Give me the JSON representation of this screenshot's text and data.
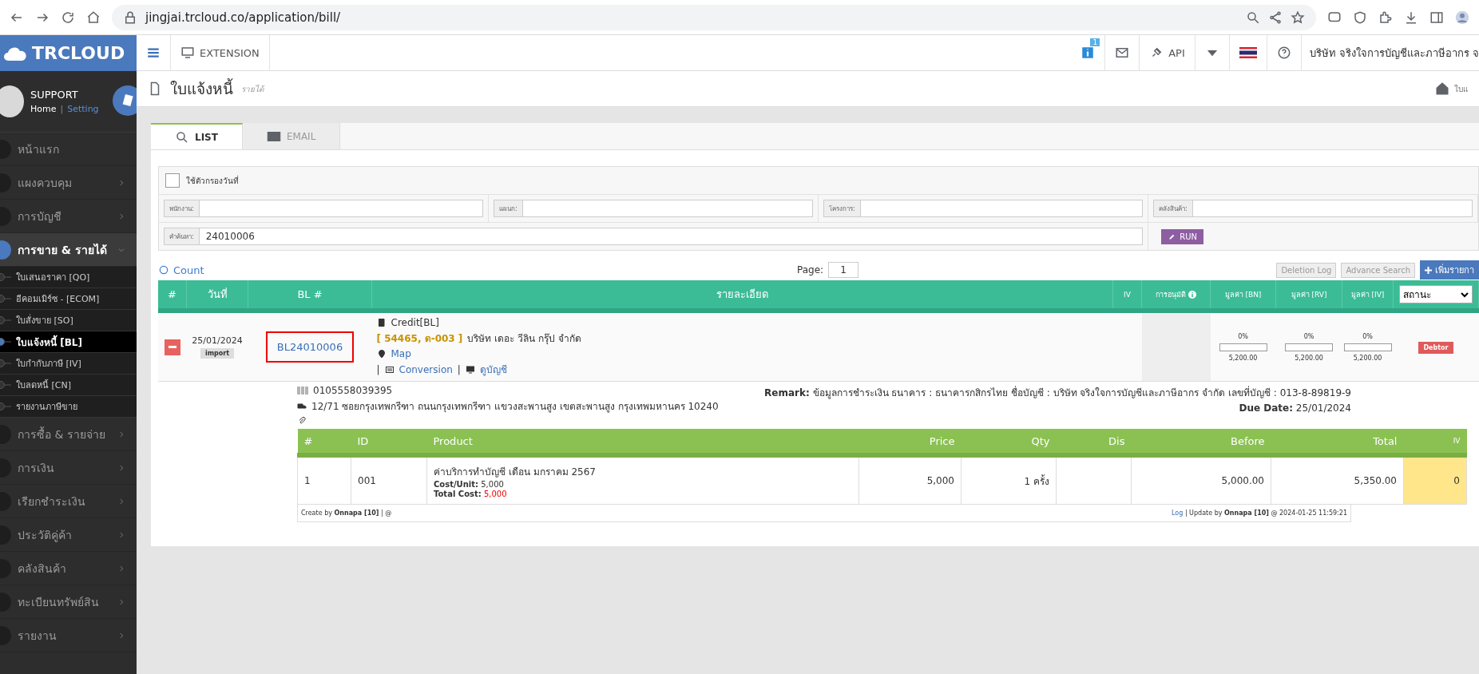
{
  "browser": {
    "url": "jingjai.trcloud.co/application/bill/"
  },
  "navbar": {
    "logo": "TRCLOUD",
    "extension": "EXTENSION",
    "notification_count": "1",
    "api": "API",
    "company": "บริษัท จริงใจการบัญชีและภาษีอากร จ"
  },
  "profile": {
    "name": "SUPPORT",
    "separator": "|",
    "links": [
      {
        "label": "Home",
        "selected": true
      },
      {
        "label": "Setting",
        "selected": false
      }
    ]
  },
  "sidebar": {
    "items": [
      {
        "label": "หน้าแรก",
        "kind": "link",
        "expanded": false
      },
      {
        "label": "แผงควบคุม",
        "kind": "menu",
        "expanded": false
      },
      {
        "label": "การบัญชี",
        "kind": "menu",
        "expanded": false
      },
      {
        "label": "การขาย & รายได้",
        "kind": "menu",
        "expanded": true,
        "children": [
          {
            "label": "ใบเสนอราคา [QO]",
            "selected": false
          },
          {
            "label": "อีคอมเมิร์ซ - [ECOM]",
            "selected": false
          },
          {
            "label": "ใบสั่งขาย [SO]",
            "selected": false
          },
          {
            "label": "ใบแจ้งหนี้ [BL]",
            "selected": true
          },
          {
            "label": "ใบกำกับภาษี [IV]",
            "selected": false
          },
          {
            "label": "ใบลดหนี้ [CN]",
            "selected": false
          },
          {
            "label": "รายงานภาษีขาย",
            "selected": false
          }
        ]
      },
      {
        "label": "การซื้อ & รายจ่าย",
        "kind": "menu",
        "expanded": false
      },
      {
        "label": "การเงิน",
        "kind": "menu",
        "expanded": false
      },
      {
        "label": "เรียกชำระเงิน",
        "kind": "menu",
        "expanded": false
      },
      {
        "label": "ประวัติคู่ค้า",
        "kind": "menu",
        "expanded": false
      },
      {
        "label": "คลังสินค้า",
        "kind": "menu",
        "expanded": false
      },
      {
        "label": "ทะเบียนทรัพย์สิน",
        "kind": "menu",
        "expanded": false
      },
      {
        "label": "รายงาน",
        "kind": "menu",
        "expanded": false
      }
    ]
  },
  "page_header": {
    "title": "ใบแจ้งหนี้",
    "subtitle": "รายได้",
    "breadcrumb": "ใบแ"
  },
  "tabs": [
    {
      "label": "LIST",
      "selected": true
    },
    {
      "label": "EMAIL",
      "selected": false
    }
  ],
  "filter": {
    "date_filter": {
      "label": "ใช้ตัวกรองวันที่",
      "checked": false
    },
    "fields": [
      {
        "label": "พนักงาน:"
      },
      {
        "label": "แผนก:"
      },
      {
        "label": "โครงการ:"
      },
      {
        "label": "คลังสินค้า:"
      }
    ],
    "search": {
      "label": "คำค้นหา:",
      "value": "24010006"
    },
    "run": "RUN"
  },
  "toolbar": {
    "count": "Count",
    "page_label": "Page:",
    "page": "1",
    "buttons": [
      "Deletion Log",
      "Advance Search"
    ],
    "add": "เพิ่มรายกา"
  },
  "table": {
    "columns": [
      "#",
      "วันที่",
      "BL #",
      "รายละเอียด",
      "IV",
      "การอนุมัติ",
      "มูลค่า [BN]",
      "มูลค่า [RV]",
      "มูลค่า [IV]"
    ],
    "status_select": "สถานะ",
    "rows": [
      {
        "date": "25/01/2024",
        "tag": "import",
        "number": "BL24010006",
        "highlighted": true,
        "doc_type": "Credit[BL]",
        "code": "[ 54465, ด-003 ]",
        "customer": "บริษัท เดอะ วีลิน กรุ๊ป จำกัด",
        "map": "Map",
        "separator": "|",
        "conversion": "Conversion",
        "account": "ดูบัญชี",
        "values": [
          {
            "percent": "0%",
            "level": 0,
            "amount": "5,200.00"
          },
          {
            "percent": "0%",
            "level": 0,
            "amount": "5,200.00"
          },
          {
            "percent": "0%",
            "level": 0,
            "amount": "5,200.00"
          }
        ],
        "status": "Debtor"
      }
    ]
  },
  "detail": {
    "tax_id": "0105558039395",
    "address": "12/71 ซอยกรุงเทพกรีฑา ถนนกรุงเทพกรีฑา แขวงสะพานสูง เขตสะพานสูง กรุงเทพมหานคร 10240",
    "remark": "**Remark:** ข้อมูลการชำระเงิน ธนาคาร : ธนาคารกสิกรไทย ชื่อบัญชี : บริษัท จริงใจการบัญชีและภาษีอากร จำกัด เลขที่บัญชี : 013-8-89819-9",
    "due": "**Due Date:** 25/01/2024",
    "columns": [
      "#",
      "ID",
      "Product",
      "Price",
      "Qty",
      "Dis",
      "Before",
      "Total",
      "IV"
    ],
    "items": [
      {
        "no": "1",
        "id": "001",
        "product": "ค่าบริการทำบัญชี เดือน มกราคม 2567",
        "cost_unit": "**Cost/Unit:** 5,000",
        "total_cost_label": "Total Cost:",
        "total_cost": "5,000",
        "price": "5,000",
        "qty": "1 ครั้ง",
        "before": "5,000.00",
        "total": "5,350.00",
        "iv": "0"
      }
    ],
    "created": "Create by **Onnapa [10]** | @",
    "log": "Log",
    "updated": "| Update by **Onnapa [10]** @ 2024-01-25 11:59:21"
  }
}
